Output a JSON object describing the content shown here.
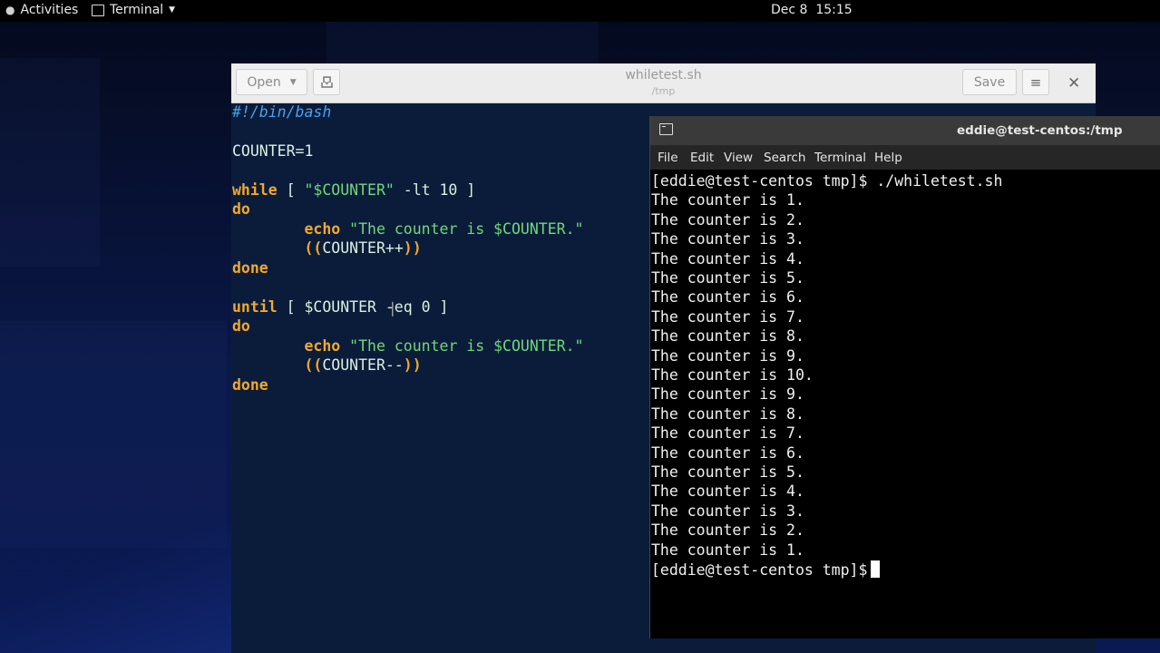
{
  "topbar": {
    "activities": "Activities",
    "app_name": "Terminal",
    "clock": "Dec 8  15:15"
  },
  "gedit": {
    "title": "whiletest.sh",
    "subtitle": "/tmp",
    "open_label": "Open",
    "save_label": "Save",
    "code": {
      "shebang": "#!/bin/bash",
      "counter_assign": "COUNTER=1",
      "kw_while": "while",
      "while_open": " [ ",
      "while_str": "\"$COUNTER\"",
      "while_rest": " -lt 10 ]",
      "kw_do": "do",
      "kw_echo": "echo",
      "echo_str": "\"The counter is $COUNTER.\"",
      "paren_open": "((",
      "inc_body": "COUNTER++",
      "dec_body": "COUNTER--",
      "paren_close": "))",
      "kw_done": "done",
      "kw_until": "until",
      "until_rest": " [ $COUNTER -eq 0 ]"
    }
  },
  "terminal": {
    "title": "eddie@test-centos:/tmp",
    "menu": [
      "File",
      "Edit",
      "View",
      "Search",
      "Terminal",
      "Help"
    ],
    "lines": [
      "[eddie@test-centos tmp]$ ./whiletest.sh",
      "The counter is 1.",
      "The counter is 2.",
      "The counter is 3.",
      "The counter is 4.",
      "The counter is 5.",
      "The counter is 6.",
      "The counter is 7.",
      "The counter is 8.",
      "The counter is 9.",
      "The counter is 10.",
      "The counter is 9.",
      "The counter is 8.",
      "The counter is 7.",
      "The counter is 6.",
      "The counter is 5.",
      "The counter is 4.",
      "The counter is 3.",
      "The counter is 2.",
      "The counter is 1."
    ],
    "prompt": "[eddie@test-centos tmp]$"
  },
  "colors": {
    "keyword": "#f0a830",
    "string": "#6fd97a",
    "comment": "#4aa0f0",
    "editor_bg": "#0b1c3a",
    "terminal_bg": "#000000"
  }
}
